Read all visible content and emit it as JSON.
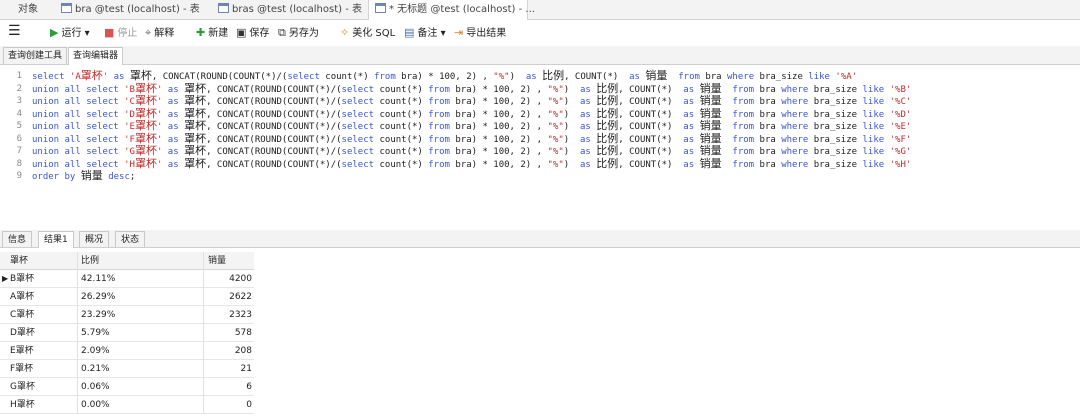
{
  "tabs": [
    {
      "label": "对象"
    },
    {
      "label": "bra @test (localhost) - 表"
    },
    {
      "label": "bras @test (localhost) - 表"
    },
    {
      "label": "* 无标题 @test (localhost) - ..."
    }
  ],
  "toolbar": {
    "menu_icon": "hamburger-icon",
    "run": "运行",
    "stop": "停止",
    "explain": "解释",
    "new": "新建",
    "save": "保存",
    "save_as": "另存为",
    "beautify": "美化 SQL",
    "comment": "备注",
    "export": "导出结果"
  },
  "editor_tabs": [
    {
      "label": "查询创建工具"
    },
    {
      "label": "查询编辑器"
    }
  ],
  "editor": {
    "lines": [
      {
        "n": "1",
        "pre": "",
        "q": "A"
      },
      {
        "n": "2",
        "pre": "union all ",
        "q": "B"
      },
      {
        "n": "3",
        "pre": "union all ",
        "q": "C"
      },
      {
        "n": "4",
        "pre": "union all ",
        "q": "D"
      },
      {
        "n": "5",
        "pre": "union all ",
        "q": "E"
      },
      {
        "n": "6",
        "pre": "union all ",
        "q": "F"
      },
      {
        "n": "7",
        "pre": "union all ",
        "q": "G"
      },
      {
        "n": "8",
        "pre": "union all ",
        "q": "H"
      }
    ],
    "last_line_number": "9",
    "tokens": {
      "select": "select ",
      "as": " as ",
      "cup": "罩杯",
      "concat": ", CONCAT(ROUND(COUNT(*)/(",
      "select2": "select",
      "count": " count(*) ",
      "from": "from",
      "bra_tail": " bra) * 100, 2) , ",
      "pct": "\"%\"",
      "close": ") ",
      "ratio": "比例",
      "count2": ", COUNT(*) ",
      "sales": "销量",
      "sp": "  ",
      "from2": "from",
      "bra2": " bra ",
      "where": "where",
      "bra_size": " bra_size ",
      "like": "like",
      "sp1": " "
    },
    "order_line": {
      "order": "order by ",
      "sales": "销量",
      "desc": " desc",
      "end": ";"
    }
  },
  "result_tabs": [
    {
      "label": "信息"
    },
    {
      "label": "结果1"
    },
    {
      "label": "概况"
    },
    {
      "label": "状态"
    }
  ],
  "grid": {
    "headers": [
      "罩杯",
      "比例",
      "销量"
    ],
    "rows": [
      [
        "B罩杯",
        "42.11%",
        "4200"
      ],
      [
        "A罩杯",
        "26.29%",
        "2622"
      ],
      [
        "C罩杯",
        "23.29%",
        "2323"
      ],
      [
        "D罩杯",
        "5.79%",
        "578"
      ],
      [
        "E罩杯",
        "2.09%",
        "208"
      ],
      [
        "F罩杯",
        "0.21%",
        "21"
      ],
      [
        "G罩杯",
        "0.06%",
        "6"
      ],
      [
        "H罩杯",
        "0.00%",
        "0"
      ]
    ]
  }
}
